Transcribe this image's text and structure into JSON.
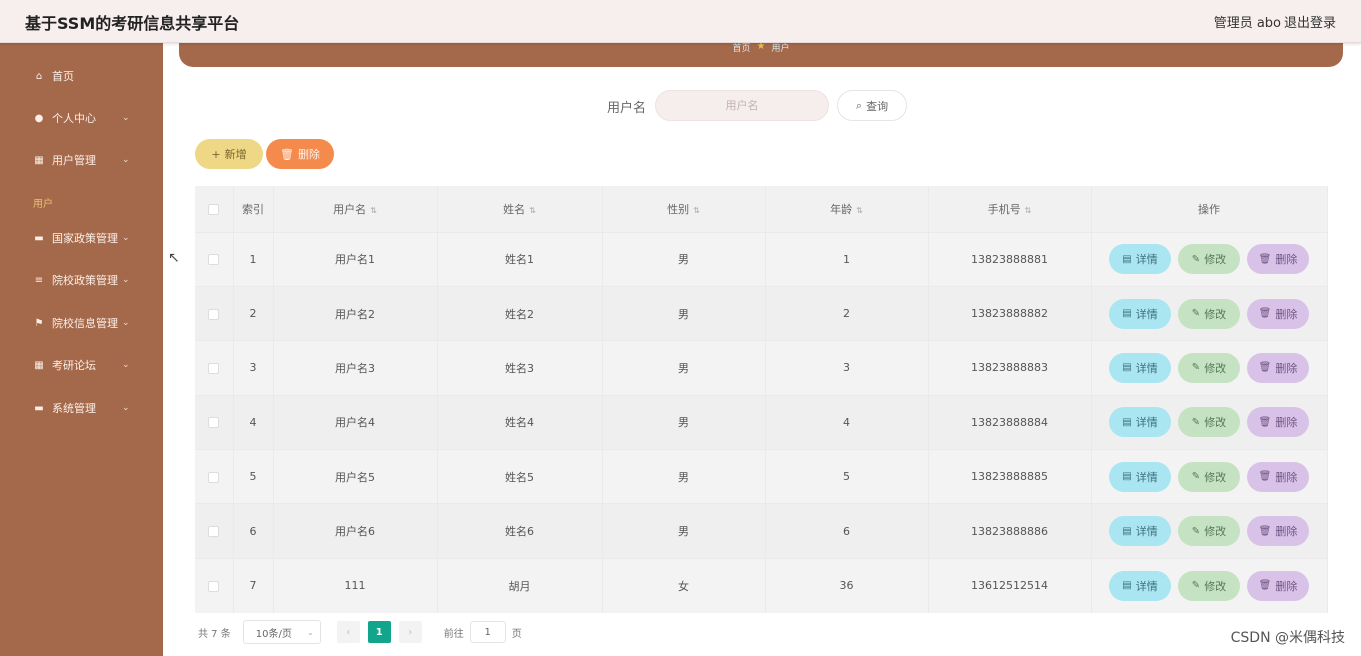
{
  "header": {
    "title": "基于SSM的考研信息共享平台",
    "admin": "管理员 abo",
    "logout": "退出登录"
  },
  "sidebar": {
    "items": [
      {
        "label": "首页",
        "icon": "⌂",
        "chevron": ""
      },
      {
        "label": "个人中心",
        "icon": "●",
        "chevron": "⌄"
      },
      {
        "label": "用户管理",
        "icon": "▦",
        "chevron": "⌄"
      },
      {
        "label": "国家政策管理",
        "icon": "▬",
        "chevron": "⌄"
      },
      {
        "label": "院校政策管理",
        "icon": "≡",
        "chevron": "⌄"
      },
      {
        "label": "院校信息管理",
        "icon": "⚑",
        "chevron": "⌄"
      },
      {
        "label": "考研论坛",
        "icon": "▦",
        "chevron": "⌄"
      },
      {
        "label": "系统管理",
        "icon": "▬",
        "chevron": "⌄"
      }
    ],
    "sub_label": "用户"
  },
  "breadcrumb": {
    "home": "首页",
    "current": "用户",
    "star": "★"
  },
  "search": {
    "label": "用户名",
    "placeholder": "用户名",
    "button": "查询",
    "button_icon": "⌕"
  },
  "actions": {
    "add": "新增",
    "add_icon": "+",
    "delete": "删除",
    "delete_icon": "🗑"
  },
  "table": {
    "headers": {
      "index": "索引",
      "username": "用户名",
      "name": "姓名",
      "gender": "性别",
      "age": "年龄",
      "phone": "手机号",
      "ops": "操作"
    },
    "sort_icon": "⇅",
    "rows": [
      {
        "index": "1",
        "username": "用户名1",
        "name": "姓名1",
        "gender": "男",
        "age": "1",
        "phone": "13823888881"
      },
      {
        "index": "2",
        "username": "用户名2",
        "name": "姓名2",
        "gender": "男",
        "age": "2",
        "phone": "13823888882"
      },
      {
        "index": "3",
        "username": "用户名3",
        "name": "姓名3",
        "gender": "男",
        "age": "3",
        "phone": "13823888883"
      },
      {
        "index": "4",
        "username": "用户名4",
        "name": "姓名4",
        "gender": "男",
        "age": "4",
        "phone": "13823888884"
      },
      {
        "index": "5",
        "username": "用户名5",
        "name": "姓名5",
        "gender": "男",
        "age": "5",
        "phone": "13823888885"
      },
      {
        "index": "6",
        "username": "用户名6",
        "name": "姓名6",
        "gender": "男",
        "age": "6",
        "phone": "13823888886"
      },
      {
        "index": "7",
        "username": "111",
        "name": "胡月",
        "gender": "女",
        "age": "36",
        "phone": "13612512514"
      }
    ],
    "row_buttons": {
      "detail": "详情",
      "detail_icon": "▤",
      "edit": "修改",
      "edit_icon": "✎",
      "delete": "删除",
      "delete_icon": "🗑"
    }
  },
  "pagination": {
    "total": "共 7 条",
    "page_size": "10条/页",
    "page_size_chevron": "⌄",
    "prev": "‹",
    "current": "1",
    "next": "›",
    "goto_label": "前往",
    "goto_value": "1",
    "goto_suffix": "页"
  },
  "watermark": "CSDN @米偶科技",
  "colors": {
    "sidebar": "#a4694a",
    "topbar": "#f7eeee",
    "add": "#efd885",
    "delete": "#f58a4d",
    "detail": "#a9e6f2",
    "edit": "#c5e3c2",
    "row_delete": "#d9c2e8",
    "page_active": "#11a58b"
  }
}
